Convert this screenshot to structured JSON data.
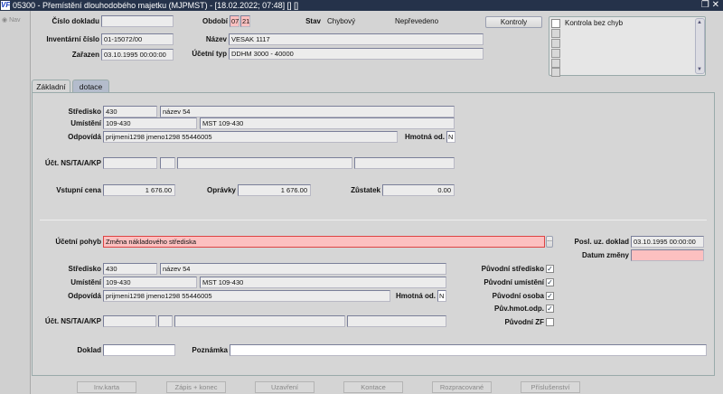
{
  "window": {
    "title": "05300 - Přemístění dlouhodobého majetku (MJPMST) - [18.02.2022; 07:48] [] []",
    "logo": "VF",
    "restore_icon": "restore-icon",
    "close_icon": "close-icon"
  },
  "nav": {
    "label": "Nav"
  },
  "header": {
    "cislo_dokladu_label": "Číslo dokladu",
    "cislo_dokladu": "",
    "inventarni_cislo_label": "Inventární číslo",
    "inventarni_cislo": "01-15072/00",
    "zarazen_label": "Zařazen",
    "zarazen": "03.10.1995 00:00:00",
    "obdobi_label": "Období",
    "obdobi_month": "07",
    "obdobi_year": "21",
    "stav_label": "Stav",
    "stav": "Chybový",
    "prevod": "Nepřevedeno",
    "nazev_label": "Název",
    "nazev": "VESAK 1117",
    "ucetni_typ_label": "Účetní typ",
    "ucetni_typ": "DDHM 3000 - 40000",
    "kontroly_button": "Kontroly",
    "checklist": [
      {
        "label": "Kontrola bez chyb",
        "checked": false
      }
    ]
  },
  "tabs": [
    {
      "label": "Základní",
      "active": true
    },
    {
      "label": "dotace",
      "active": false
    }
  ],
  "original": {
    "stredisko_label": "Středisko",
    "stredisko_code": "430",
    "stredisko_name": "název 54",
    "umisteni_label": "Umístění",
    "umisteni_code": "109-430",
    "umisteni_name": "MST 109-430",
    "odpovida_label": "Odpovídá",
    "odpovida": "prijmeni1298 jmeno1298 55446005",
    "hmotna_label": "Hmotná od.",
    "hmotna": "N",
    "ucet_label": "Účt. NS/TA/A/KP",
    "vstupni_cena_label": "Vstupní cena",
    "vstupni_cena": "1 676.00",
    "opravky_label": "Oprávky",
    "opravky": "1 676.00",
    "zustatek_label": "Zůstatek",
    "zustatek": "0.00"
  },
  "change": {
    "ucetni_pohyb_label": "Účetní pohyb",
    "ucetni_pohyb": "Změna nákladového střediska",
    "lov_button": "...",
    "posl_label": "Posl. uz. doklad",
    "posl": "03.10.1995 00:00:00",
    "datum_zmeny_label": "Datum změny",
    "datum_zmeny": "",
    "stredisko_label": "Středisko",
    "stredisko_code": "430",
    "stredisko_name": "název 54",
    "umisteni_label": "Umístění",
    "umisteni_code": "109-430",
    "umisteni_name": "MST 109-430",
    "odpovida_label": "Odpovídá",
    "odpovida": "prijmeni1298 jmeno1298 55446005",
    "hmotna_label": "Hmotná od.",
    "hmotna": "N",
    "ucet_label": "Účt. NS/TA/A/KP",
    "checks": [
      {
        "label": "Původní středisko",
        "checked": true
      },
      {
        "label": "Původní umístění",
        "checked": true
      },
      {
        "label": "Původní osoba",
        "checked": true
      },
      {
        "label": "Pův.hmot.odp.",
        "checked": true
      },
      {
        "label": "Původní ZF",
        "checked": false
      }
    ],
    "doklad_label": "Doklad",
    "doklad": "",
    "poznamka_label": "Poznámka",
    "poznamka": ""
  },
  "buttons": [
    "Inv.karta",
    "Zápis + konec",
    "Uzavření",
    "Kontace",
    "Rozpracované",
    "Příslušenství"
  ]
}
